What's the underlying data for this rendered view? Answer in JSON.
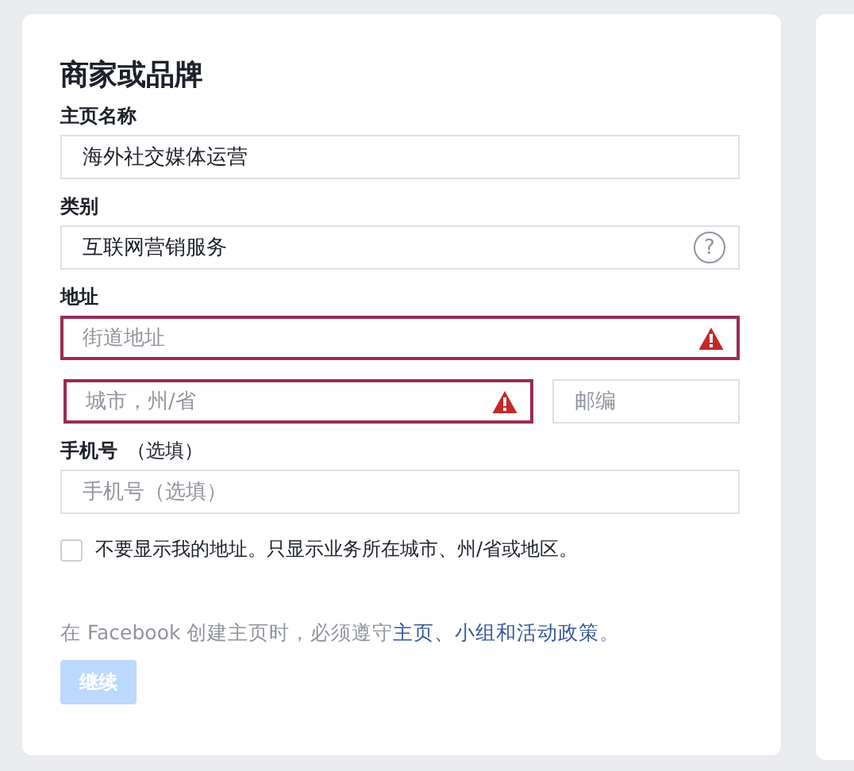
{
  "card": {
    "title": "商家或品牌",
    "page_name": {
      "label": "主页名称",
      "value": "海外社交媒体运营"
    },
    "category": {
      "label": "类别",
      "value": "互联网营销服务",
      "help": "?"
    },
    "address": {
      "label": "地址",
      "street": {
        "placeholder": "街道地址",
        "error": true
      },
      "city": {
        "placeholder": "城市，州/省",
        "error": true
      },
      "zip": {
        "placeholder": "邮编",
        "error": false
      }
    },
    "phone": {
      "label": "手机号",
      "note": "（选填）",
      "placeholder": "手机号（选填）"
    },
    "hide_address": {
      "label": "不要显示我的地址。只显示业务所在城市、州/省或地区。",
      "checked": false
    },
    "policy": {
      "before": "在 Facebook 创建主页时，必须遵守",
      "link": "主页、小组和活动政策",
      "after": "。"
    },
    "continue_button": {
      "label": "继续",
      "disabled": true
    }
  }
}
